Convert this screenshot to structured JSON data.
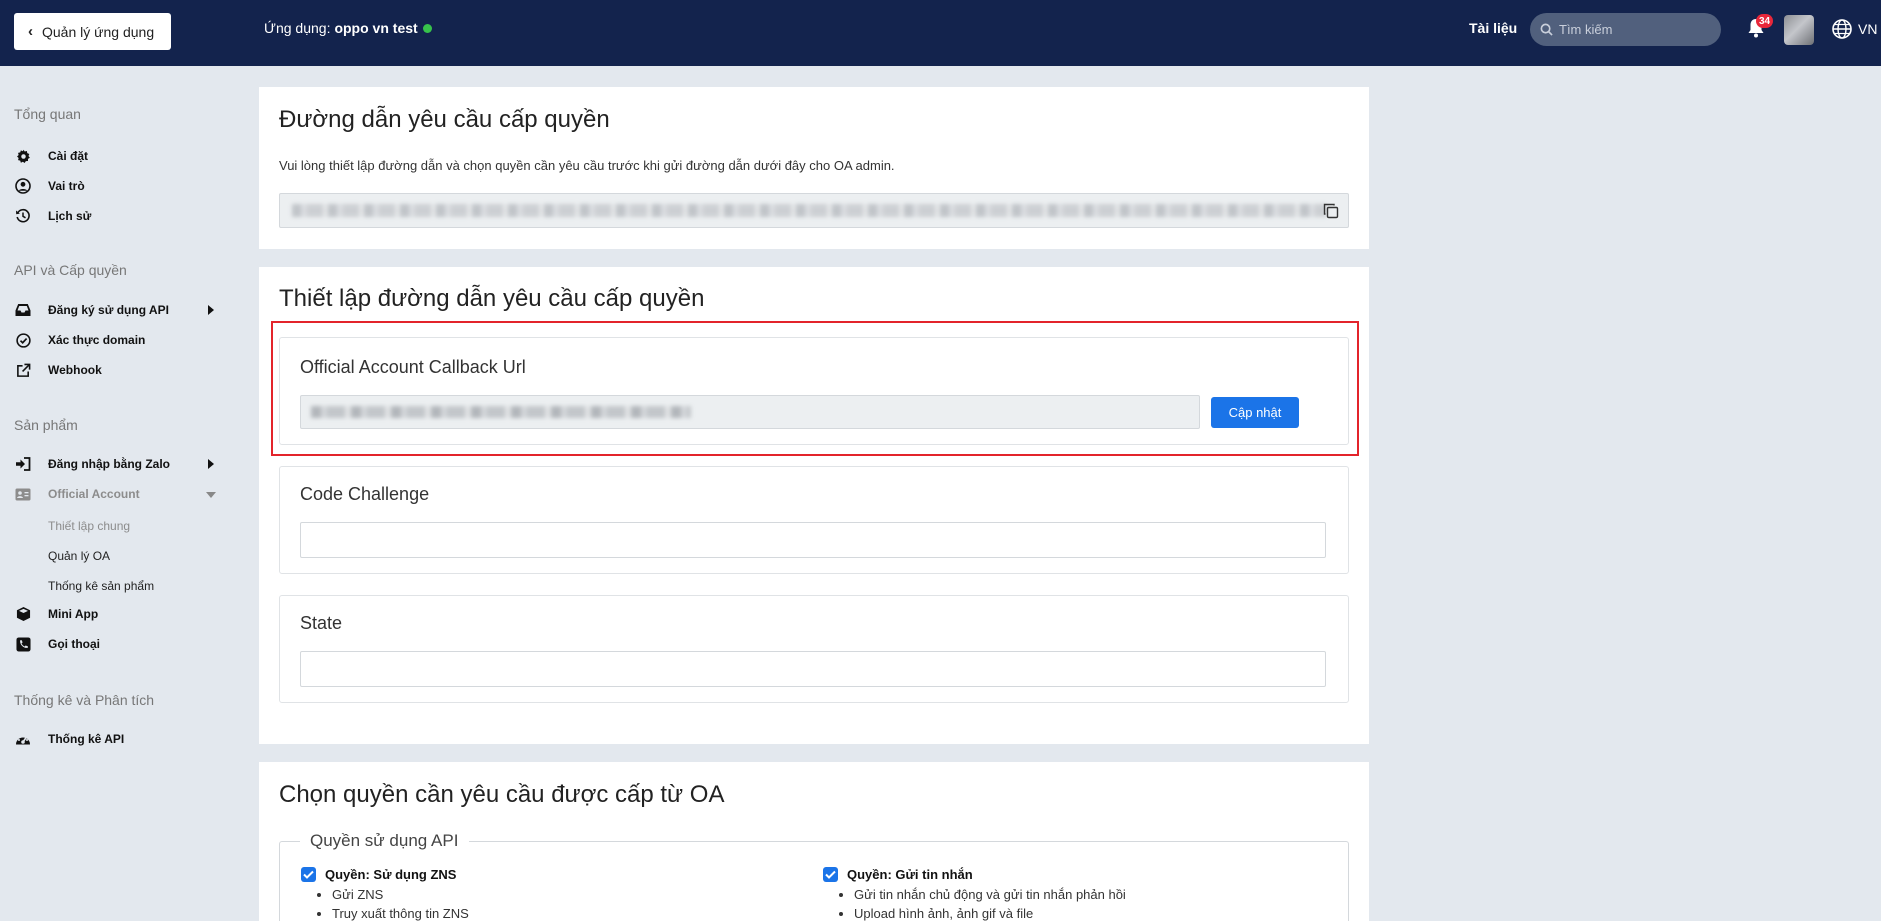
{
  "header": {
    "back_label": "Quản lý ứng dụng",
    "app_prefix": "Ứng dụng:",
    "app_name": "oppo vn test",
    "docs_label": "Tài liệu",
    "search_placeholder": "Tìm kiếm",
    "notification_count": "34",
    "language": "VN",
    "status_color": "#37c24b"
  },
  "sidebar": {
    "sections": [
      {
        "title": "Tổng quan"
      },
      {
        "title": "API và Cấp quyền"
      },
      {
        "title": "Sản phẩm"
      },
      {
        "title": "Thống kê và Phân tích"
      }
    ],
    "items": [
      {
        "label": "Cài đặt",
        "icon": "gear-icon"
      },
      {
        "label": "Vai trò",
        "icon": "user-circle-icon"
      },
      {
        "label": "Lịch sử",
        "icon": "history-icon"
      },
      {
        "label": "Đăng ký sử dụng API",
        "icon": "inbox-icon"
      },
      {
        "label": "Xác thực domain",
        "icon": "check-circle-icon"
      },
      {
        "label": "Webhook",
        "icon": "external-link-icon"
      },
      {
        "label": "Đăng nhập bằng Zalo",
        "icon": "sign-in-icon"
      },
      {
        "label": "Official Account",
        "icon": "id-card-icon"
      },
      {
        "label": "Mini App",
        "icon": "cube-icon"
      },
      {
        "label": "Gọi thoại",
        "icon": "phone-icon"
      },
      {
        "label": "Thống kê API",
        "icon": "dashboard-icon"
      }
    ],
    "sub_items": [
      {
        "label": "Thiết lập chung"
      },
      {
        "label": "Quản lý OA"
      },
      {
        "label": "Thống kê sản phẩm"
      }
    ]
  },
  "permission_link": {
    "title": "Đường dẫn yêu cầu cấp quyền",
    "description": "Vui lòng thiết lập đường dẫn và chọn quyền cần yêu cầu trước khi gửi đường dẫn dưới đây cho OA admin."
  },
  "setup": {
    "title": "Thiết lập đường dẫn yêu cầu cấp quyền",
    "callback_label": "Official Account Callback Url",
    "update_button": "Cập nhật",
    "code_challenge_label": "Code Challenge",
    "code_challenge_value": "",
    "state_label": "State",
    "state_value": "",
    "highlight_color": "#e3242b"
  },
  "permissions": {
    "title": "Chọn quyền cần yêu cầu được cấp từ OA",
    "group_label": "Quyền sử dụng API",
    "groups": [
      {
        "label": "Quyền: Sử dụng ZNS",
        "checked": true,
        "items": [
          "Gửi ZNS",
          "Truy xuất thông tin ZNS"
        ]
      },
      {
        "label": "Quyền: Gửi tin nhắn",
        "checked": true,
        "items": [
          "Gửi tin nhắn chủ động và gửi tin nhắn phản hồi",
          "Upload hình ảnh, ảnh gif và file"
        ]
      }
    ]
  },
  "colors": {
    "topbar": "#13234d",
    "primary": "#1b74e8",
    "background": "#e3e8ee"
  }
}
